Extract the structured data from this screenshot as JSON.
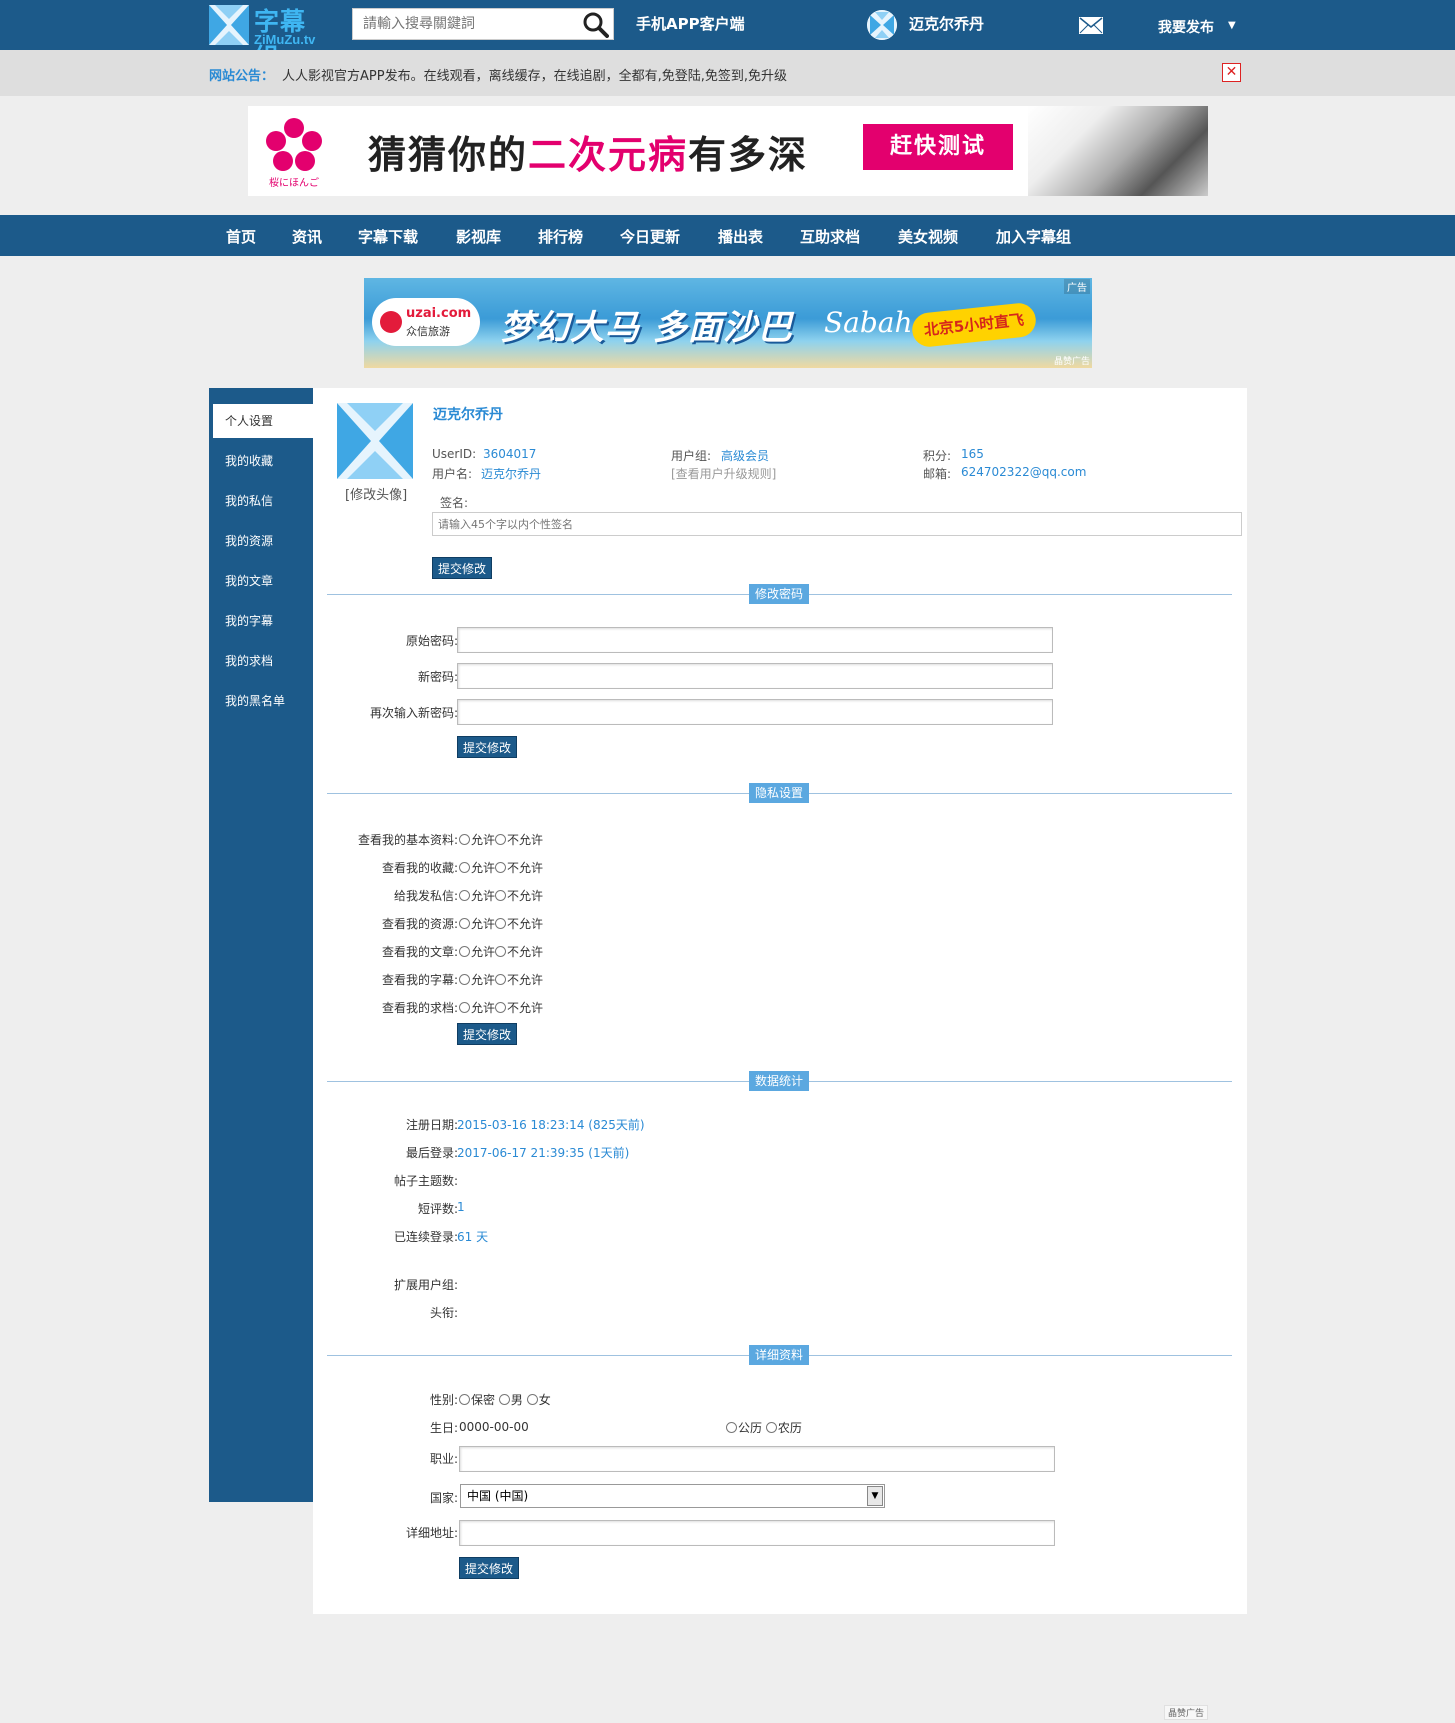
{
  "header": {
    "logo_cn": "字幕组",
    "logo_en": "ZiMuZu.tv",
    "search_placeholder": "請輸入搜尋關鍵詞",
    "app_link": "手机APP客户端",
    "username": "迈克尔乔丹",
    "publish_label": "我要发布",
    "icons": [
      "search-icon",
      "mail-icon",
      "chevron-down-icon"
    ]
  },
  "notice": {
    "label": "网站公告：",
    "text": "人人影视官方APP发布。在线观看，离线缓存，在线追剧，全都有,免登陆,免签到,免升级",
    "close_icon": "close-icon"
  },
  "ad1": {
    "brand": "桜にほんご",
    "slogan_a": "猜猜你的",
    "slogan_hl": "二次元病",
    "slogan_b": "有多深",
    "button": "赶快测试"
  },
  "nav": {
    "items": [
      "首页",
      "资讯",
      "字幕下载",
      "影视库",
      "排行榜",
      "今日更新",
      "播出表",
      "互助求档",
      "美女视频",
      "加入字幕组"
    ]
  },
  "ad2": {
    "brand_en": "uzai.com",
    "brand_cn": "众信旅游",
    "slogan": "梦幻大马 多面沙巴",
    "sabah": "Sabah",
    "tag": "北京5小时直飞",
    "flag": "广告",
    "foot": "晶赞广告"
  },
  "sidebar": {
    "items": [
      "个人设置",
      "我的收藏",
      "我的私信",
      "我的资源",
      "我的文章",
      "我的字幕",
      "我的求档",
      "我的黑名单"
    ]
  },
  "profile": {
    "name": "迈克尔乔丹",
    "avatar_edit": "[修改头像]",
    "userid_label": "UserID:",
    "userid": "3604017",
    "username_label": "用户名:",
    "username": "迈克尔乔丹",
    "group_label": "用户组:",
    "group": "高级会员",
    "upgrade_rules": "[查看用户升级规则]",
    "points_label": "积分:",
    "points": "165",
    "email_label": "邮箱:",
    "email": "624702322@qq.com",
    "signature_label": "签名:",
    "signature_placeholder": "请输入45个字以内个性签名",
    "submit": "提交修改"
  },
  "password": {
    "section": "修改密码",
    "old_label": "原始密码:",
    "new_label": "新密码:",
    "confirm_label": "再次输入新密码:",
    "submit": "提交修改"
  },
  "privacy": {
    "section": "隐私设置",
    "allow": "允许",
    "deny": "不允许",
    "rows": [
      "查看我的基本资料:",
      "查看我的收藏:",
      "给我发私信:",
      "查看我的资源:",
      "查看我的文章:",
      "查看我的字幕:",
      "查看我的求档:"
    ],
    "submit": "提交修改"
  },
  "stats": {
    "section": "数据统计",
    "reg_label": "注册日期:",
    "reg_value": "2015-03-16 18:23:14 (825天前)",
    "last_label": "最后登录:",
    "last_value": "2017-06-17 21:39:35 (1天前)",
    "topics_label": "帖子主题数:",
    "reviews_label": "短评数:",
    "reviews_value": "1",
    "streak_label": "已连续登录:",
    "streak_value": "61 天",
    "ext_group_label": "扩展用户组:",
    "title_label": "头衔:"
  },
  "details": {
    "section": "详细资料",
    "gender_label": "性别:",
    "gender_options": [
      "保密",
      "男",
      "女"
    ],
    "birthday_label": "生日:",
    "birthday_value": "0000-00-00",
    "calendar_options": [
      "公历",
      "农历"
    ],
    "job_label": "职业:",
    "country_label": "国家:",
    "country_value": "中国 (中国)",
    "address_label": "详细地址:",
    "submit": "提交修改"
  },
  "footer": {
    "ad_tag": "晶赞广告"
  },
  "colors": {
    "brand_blue": "#1c5a8a",
    "link_blue": "#2a8ad4",
    "section_blue": "#5ba8e0",
    "ad_pink": "#e3006e"
  }
}
